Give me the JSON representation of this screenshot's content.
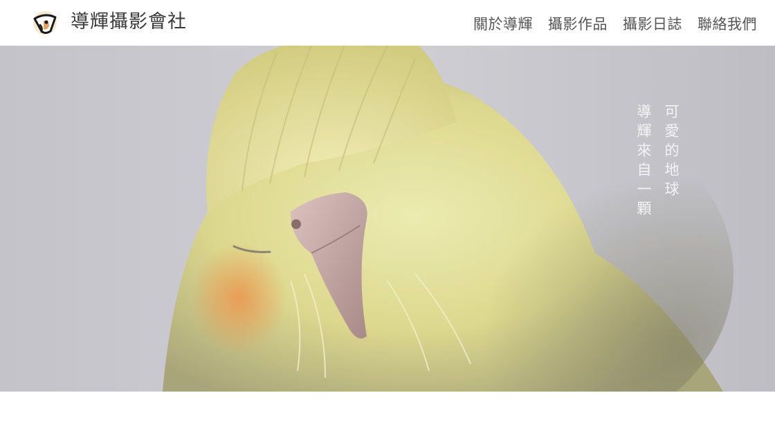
{
  "site": {
    "title": "導輝攝影會社",
    "logo_icon": "parrot-logo-icon"
  },
  "nav": {
    "items": [
      {
        "label": "關於導輝"
      },
      {
        "label": "攝影作品"
      },
      {
        "label": "攝影日誌"
      },
      {
        "label": "聯絡我們"
      }
    ]
  },
  "hero": {
    "image_subject": "cockatiel-photo",
    "tagline_line1": "可愛的地球",
    "tagline_line2": "導輝來自一顆"
  },
  "colors": {
    "background": "#ffffff",
    "text_dark": "#3a3a3a",
    "nav_text": "#555555",
    "hero_bg": "#bfbfc6",
    "bird_yellow": "#e6e29a",
    "cheek_orange": "#e8a25c",
    "beak": "#c9a8a6"
  }
}
